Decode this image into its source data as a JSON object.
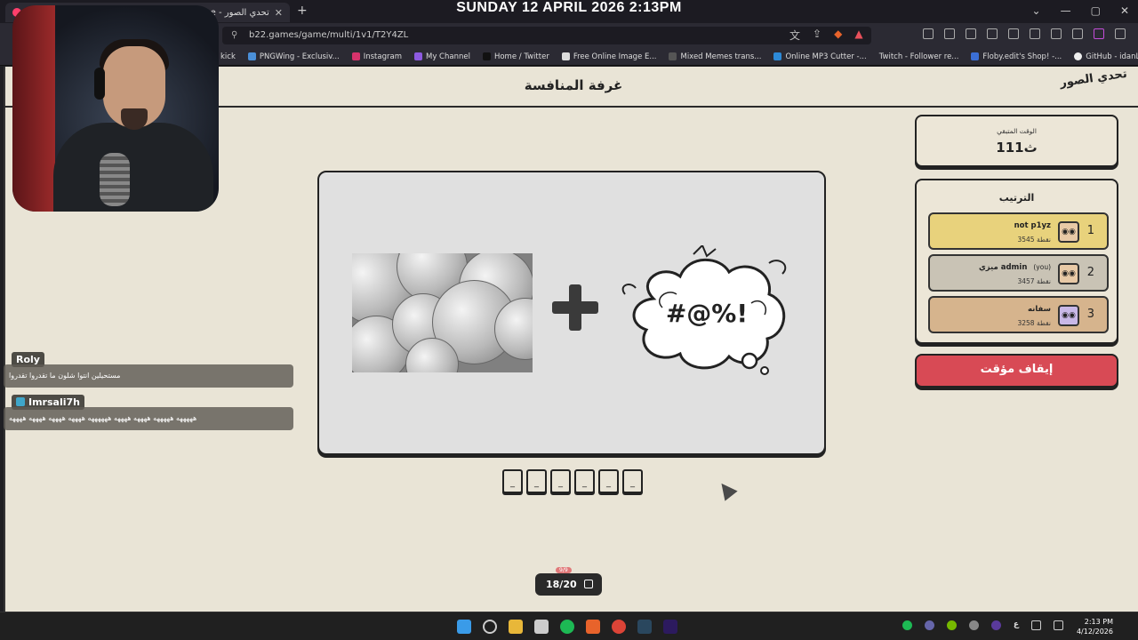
{
  "overlay": {
    "date": "SUNDAY 12 APRIL 2026 2:13PM"
  },
  "browser": {
    "tab_title": "Photo Challenge - تحدي الصور",
    "tab_close": "✕",
    "new_tab": "+",
    "url": "b22.games/game/multi/1v1/T2Y4ZL",
    "bookmarks": [
      "kick",
      "PNGWing - Exclusiv...",
      "Instagram",
      "My Channel",
      "Home / Twitter",
      "Free Online Image E...",
      "Mixed Memes trans...",
      "Online MP3 Cutter -...",
      "Twitch - Follower re...",
      "Floby.edit's Shop! -...",
      "GitHub - idanL/Inst..."
    ],
    "window_controls": [
      "⌄",
      "—",
      "▢",
      "✕"
    ]
  },
  "page": {
    "logo": "تحدي الصور",
    "room_title": "غرفة المنافسة",
    "timer": {
      "label": "الوقت المتبقي",
      "value": "111ث"
    },
    "ranking": {
      "title": "الترتيب",
      "rows": [
        {
          "rank": "1",
          "name": "not p1yz",
          "you": "",
          "points": "3545 نقطة",
          "color": "#e8d27c"
        },
        {
          "rank": "2",
          "name": "ميزي admin",
          "you": "(you)",
          "points": "3457 نقطة",
          "color": "#c9c3b5"
        },
        {
          "rank": "3",
          "name": "سفانه",
          "you": "",
          "points": "3258 نقطة",
          "color": "#d6b48d"
        }
      ]
    },
    "pause_button": "إيقاف مؤقت",
    "cloud_text": "#@%!",
    "answer_slots": [
      "_",
      "_",
      "_",
      "_",
      "_",
      "_"
    ],
    "progress": "18/20",
    "progress_badge": "9/9"
  },
  "chat": [
    {
      "user": "Roly",
      "message": "مستحيلين انتوا شلون ما تقدروا تقدروا"
    },
    {
      "user": "Imrsali7h",
      "message": "هههههه هههههه ههههه ههههه ههههههه ههههه ههههه ههههه ههههه"
    }
  ],
  "taskbar": {
    "time": "2:13 PM",
    "date": "4/12/2026",
    "lang": "ع"
  }
}
